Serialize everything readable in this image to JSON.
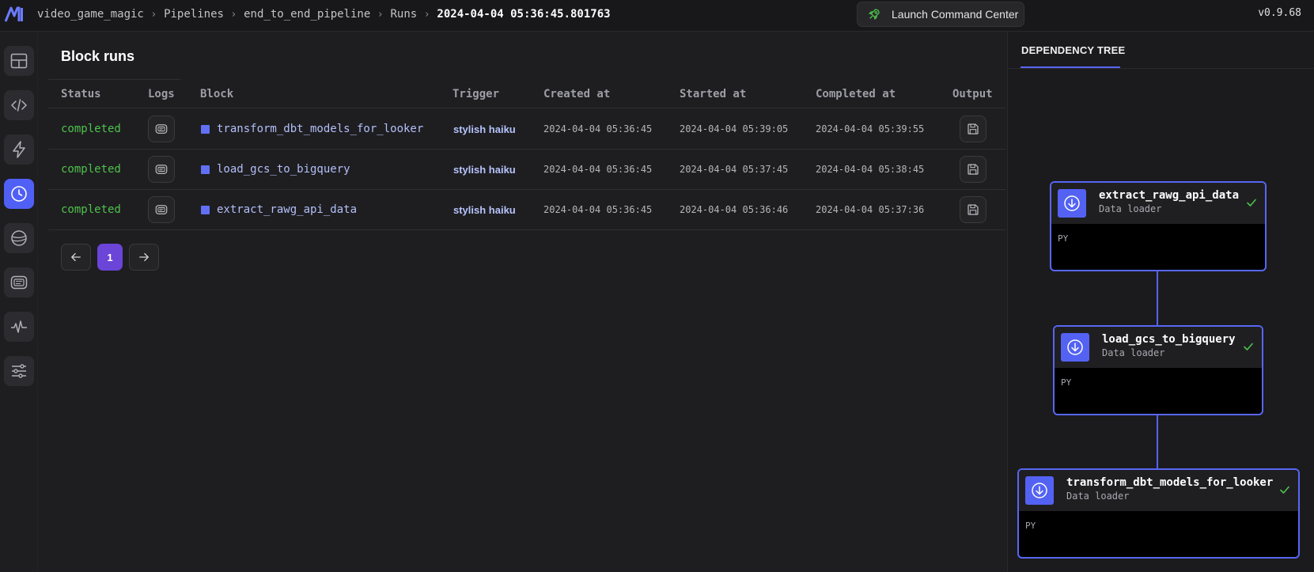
{
  "header": {
    "breadcrumbs": [
      {
        "label": "video_game_magic"
      },
      {
        "label": "Pipelines"
      },
      {
        "label": "end_to_end_pipeline"
      },
      {
        "label": "Runs"
      },
      {
        "label": "2024-04-04 05:36:45.801763"
      }
    ],
    "launch_label": "Launch Command Center",
    "version": "v0.9.68"
  },
  "nav": {
    "items": [
      "layout-icon",
      "code-icon",
      "lightning-icon",
      "clock-icon",
      "planet-icon",
      "terminal-icon",
      "pulse-icon",
      "sliders-icon"
    ],
    "active": "clock-icon"
  },
  "main": {
    "title": "Block runs",
    "columns": [
      "Status",
      "Logs",
      "Block",
      "Trigger",
      "Created at",
      "Started at",
      "Completed at",
      "Output"
    ],
    "rows": [
      {
        "status": "completed",
        "block": "transform_dbt_models_for_looker",
        "trigger": "stylish haiku",
        "created": "2024-04-04 05:36:45",
        "started": "2024-04-04 05:39:05",
        "completed": "2024-04-04 05:39:55"
      },
      {
        "status": "completed",
        "block": "load_gcs_to_bigquery",
        "trigger": "stylish haiku",
        "created": "2024-04-04 05:36:45",
        "started": "2024-04-04 05:37:45",
        "completed": "2024-04-04 05:38:45"
      },
      {
        "status": "completed",
        "block": "extract_rawg_api_data",
        "trigger": "stylish haiku",
        "created": "2024-04-04 05:36:45",
        "started": "2024-04-04 05:36:46",
        "completed": "2024-04-04 05:37:36"
      }
    ],
    "pagination": {
      "current": "1"
    }
  },
  "dependency_tree": {
    "tab_label": "DEPENDENCY TREE",
    "nodes": [
      {
        "name": "extract_rawg_api_data",
        "type": "Data loader",
        "lang": "PY"
      },
      {
        "name": "load_gcs_to_bigquery",
        "type": "Data loader",
        "lang": "PY"
      },
      {
        "name": "transform_dbt_models_for_looker",
        "type": "Data loader",
        "lang": "PY"
      }
    ]
  },
  "colors": {
    "accent": "#5865f2",
    "status_completed": "#4ec24a",
    "page_active": "#6b44d8"
  }
}
